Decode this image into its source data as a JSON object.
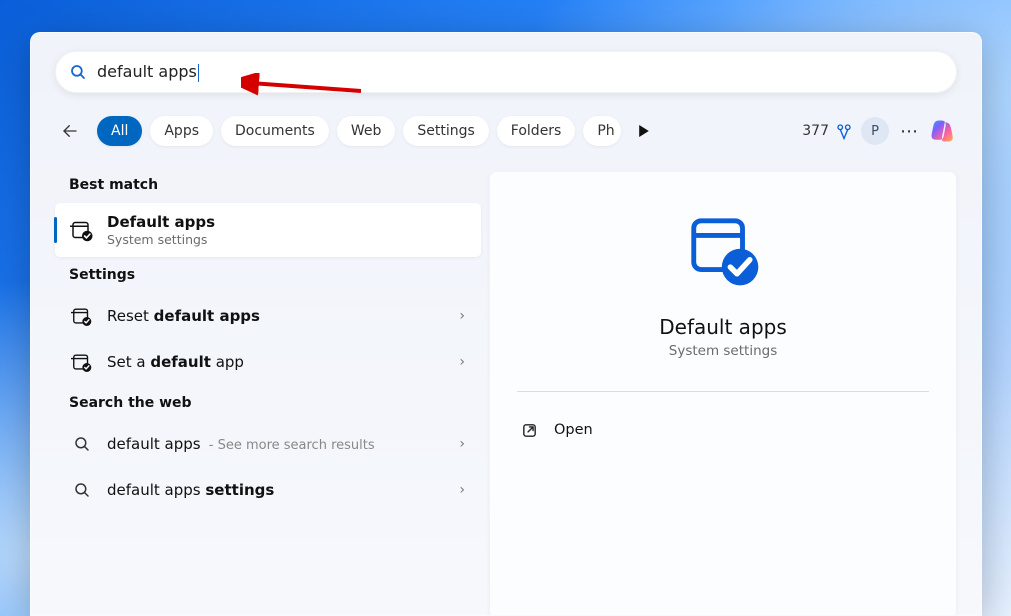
{
  "search": {
    "query": "default apps"
  },
  "filters": {
    "all": "All",
    "apps": "Apps",
    "documents": "Documents",
    "web": "Web",
    "settings": "Settings",
    "folders": "Folders",
    "photos_truncated": "Ph"
  },
  "toolbar": {
    "points": "377",
    "avatar_initial": "P"
  },
  "sections": {
    "best_match": "Best match",
    "settings": "Settings",
    "search_web": "Search the web"
  },
  "best_match": {
    "title": "Default apps",
    "subtitle": "System settings"
  },
  "settings_results": [
    {
      "prefix": "Reset ",
      "bold": "default apps",
      "suffix": ""
    },
    {
      "prefix": "Set a ",
      "bold": "default",
      "suffix": " app"
    }
  ],
  "web_results": [
    {
      "query": "default apps",
      "hint": " - See more search results"
    },
    {
      "query_prefix": "default apps ",
      "query_bold": "settings",
      "hint": ""
    }
  ],
  "detail": {
    "title": "Default apps",
    "subtitle": "System settings",
    "open_label": "Open"
  }
}
